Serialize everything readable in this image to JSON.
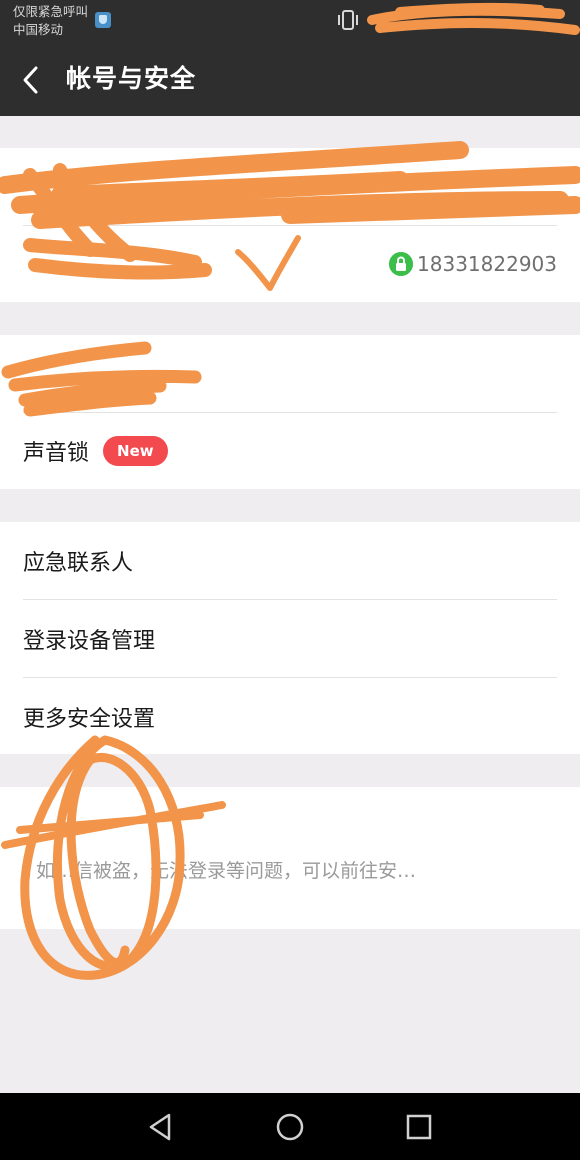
{
  "status": {
    "line1": "仅限紧急呼叫",
    "line2": "中国移动"
  },
  "header": {
    "title": "帐号与安全"
  },
  "account": {
    "phone": "18331822903"
  },
  "security": {
    "voice_lock": "声音锁",
    "voice_lock_badge": "New"
  },
  "menu": {
    "emergency_contact": "应急联系人",
    "device_management": "登录设备管理",
    "more_settings": "更多安全设置"
  },
  "help": {
    "description": "如…信被盗，无法登录等问题，可以前往安…"
  },
  "icons": {
    "back": "back-arrow-icon",
    "lock": "lock-icon",
    "vibrate": "vibrate-icon",
    "sim": "sim-shield-icon",
    "nav_back": "triangle-back-icon",
    "nav_home": "circle-home-icon",
    "nav_recent": "square-recent-icon"
  },
  "colors": {
    "header_bg": "#2e2e2e",
    "page_bg": "#efedf0",
    "badge_red": "#f24a4f",
    "lock_green": "#3cbf4a",
    "scribble_orange": "#f2954a"
  }
}
